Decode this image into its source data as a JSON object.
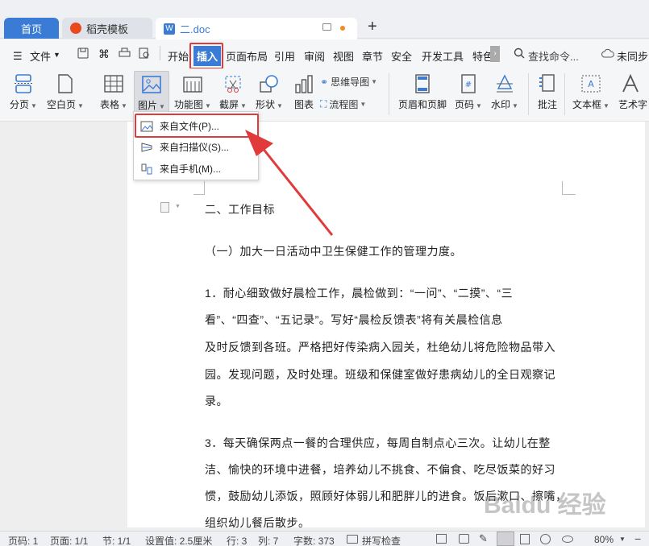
{
  "tabs": {
    "home": "首页",
    "doke": "稻壳模板",
    "doc": "二.doc",
    "new_tab": "+"
  },
  "menu": {
    "file": "文件",
    "items": [
      "开始",
      "插入",
      "页面布局",
      "引用",
      "审阅",
      "视图",
      "章节",
      "安全",
      "开发工具",
      "特色"
    ],
    "search": "查找命令...",
    "sync": "未同步"
  },
  "ribbon": {
    "buttons": [
      "分页",
      "空白页",
      "表格",
      "图片",
      "功能图",
      "截屏",
      "形状",
      "图表",
      "页眉和页脚",
      "页码",
      "水印",
      "批注",
      "文本框",
      "艺术字"
    ],
    "mindmap": "思维导图",
    "flowchart": "流程图"
  },
  "dropdown": {
    "items": [
      "来自文件(P)...",
      "来自扫描仪(S)...",
      "来自手机(M)..."
    ]
  },
  "doc": {
    "lines": [
      "二、工作目标",
      "（一）加大一日活动中卫生保健工作的管理力度。",
      "1．耐心细致做好晨检工作，晨检做到：“一问”、“二摸”、“三",
      "看”、“四查”、“五记录”。写好“晨检反馈表”将有关晨检信息",
      "及时反馈到各班。严格把好传染病入园关，杜绝幼儿将危险物品带入",
      "园。发现问题，及时处理。班级和保健室做好患病幼儿的全日观察记",
      "录。",
      "3．每天确保两点一餐的合理供应，每周自制点心三次。让幼儿在整",
      "洁、愉快的环境中进餐，培养幼儿不挑食、不偏食、吃尽饭菜的好习",
      "惯，鼓励幼儿添饭，照顾好体弱儿和肥胖儿的进食。饭后漱口、擦嘴，",
      "组织幼儿餐后散步。"
    ]
  },
  "status": {
    "page_num": "页码: 1",
    "pages": "页面: 1/1",
    "section": "节: 1/1",
    "setting": "设置值: 2.5厘米",
    "row": "行: 3",
    "col": "列: 7",
    "words": "字数: 373",
    "spell": "拼写检查",
    "zoom": "80%"
  },
  "watermark": "Baidu 经验",
  "colors": {
    "accent": "#3a7bd5",
    "highlight": "#e03a3a"
  }
}
